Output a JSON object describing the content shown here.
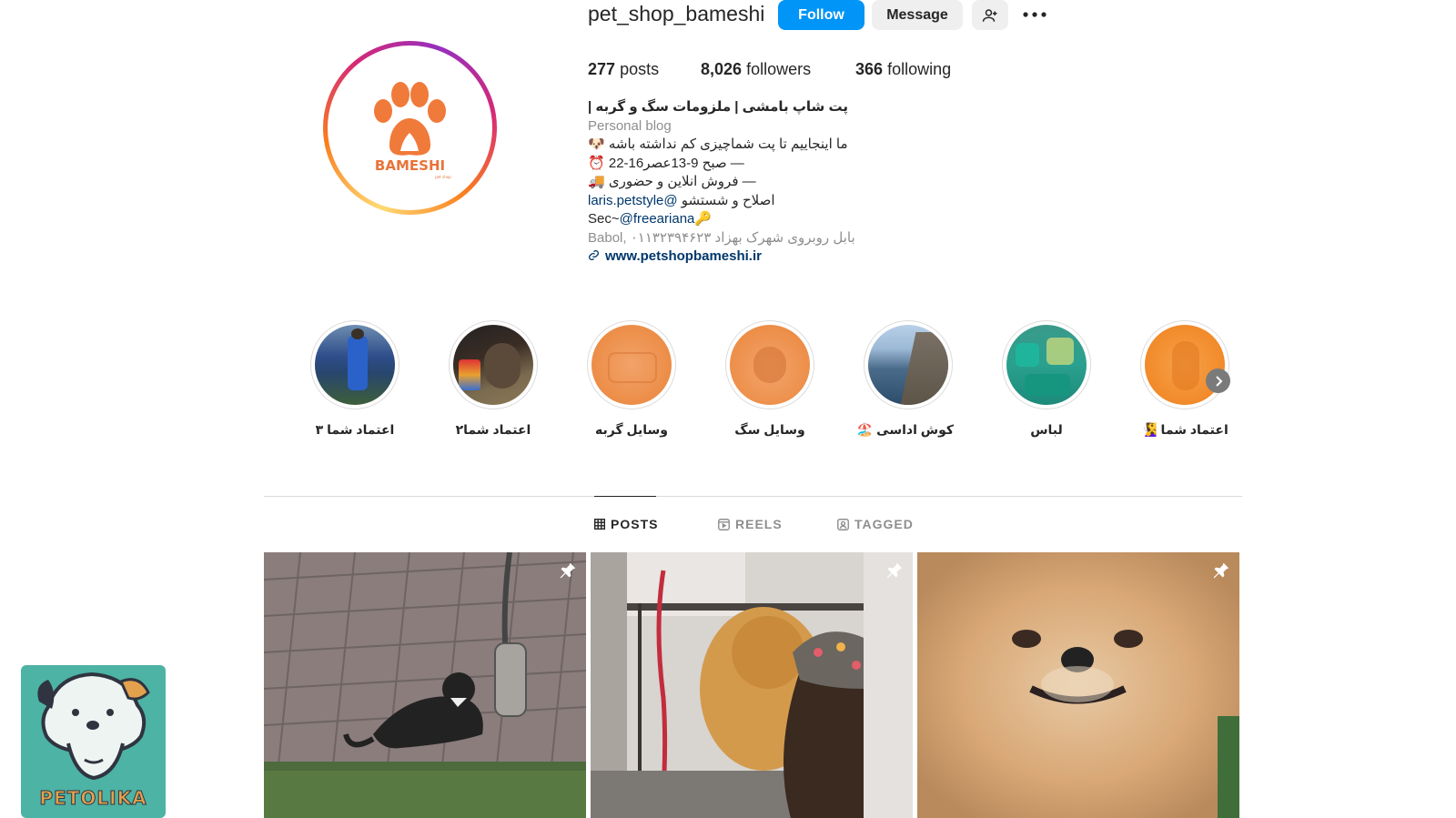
{
  "profile": {
    "username": "pet_shop_bameshi",
    "follow_label": "Follow",
    "message_label": "Message",
    "add_user_icon": "add-user-icon",
    "more_icon": "more-horizontal-icon",
    "avatar_text": "BAMESHI",
    "avatar_subtext": "pet shop"
  },
  "stats": {
    "posts_count": "277",
    "posts_label": "posts",
    "followers_count": "8,026",
    "followers_label": "followers",
    "following_count": "366",
    "following_label": "following"
  },
  "bio": {
    "name": "پت شاپ بامشی | ملزومات سگ و گربه |",
    "category": "Personal blog",
    "line1": "ما اینجاییم تا پت شماچیزی کم نداشته باشه 🐶",
    "line2": "— صبح 9-13عصر16-22 ⏰",
    "line3": "— فروش انلاین و حضوری 🚚",
    "line4_text": "اصلاح و شستشو",
    "line4_mention": "@laris.petstyle",
    "line5_prefix": "Sec~",
    "line5_mention": "@freeariana",
    "line5_suffix": "🔑",
    "address": "بابل روبروی شهرک بهزاد ۰۱۱۳۲۳۹۴۶۲۳ ,Babol",
    "website": "www.petshopbameshi.ir",
    "link_icon": "link-icon"
  },
  "highlights": [
    {
      "label": "اعتماد شما ۳"
    },
    {
      "label": "اعتماد شما۲"
    },
    {
      "label": "وسایل گربه"
    },
    {
      "label": "وسایل سگ"
    },
    {
      "label": "کوش اداسی 🏖️"
    },
    {
      "label": "لباس"
    },
    {
      "label": "اعتماد شما 🧏‍♀️"
    }
  ],
  "tabs": [
    {
      "label": "POSTS",
      "icon": "grid-icon",
      "active": true
    },
    {
      "label": "REELS",
      "icon": "reels-icon",
      "active": false
    },
    {
      "label": "TAGGED",
      "icon": "tagged-icon",
      "active": false
    }
  ],
  "posts": [
    {
      "subject": "cat",
      "pinned": true
    },
    {
      "subject": "chow-chow",
      "pinned": true
    },
    {
      "subject": "pomeranian",
      "pinned": true
    }
  ],
  "watermark": {
    "text": "PETOLIKA"
  },
  "colors": {
    "follow_blue": "#0095f6",
    "link_blue": "#00376b",
    "muted_gray": "#8e8e8e",
    "watermark_teal": "#4db3a4"
  }
}
